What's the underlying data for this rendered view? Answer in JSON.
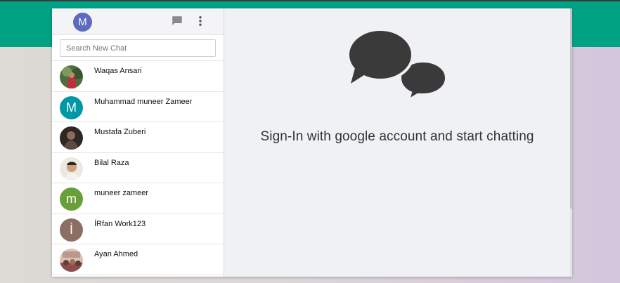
{
  "colors": {
    "top_band": "#00a284",
    "page_bg": "#d9d3da",
    "panel_bg": "#f0f1f5",
    "icon_gray": "#8a8a8a",
    "bubble_dark": "#3a3a3a"
  },
  "sidebar": {
    "me": {
      "initial": "M",
      "color": "#5c6bc0"
    },
    "header_icons": [
      "chat-bubble-icon",
      "more-vert-icon"
    ],
    "search": {
      "placeholder": "Search New Chat",
      "value": ""
    },
    "contacts": [
      {
        "name": "Waqas Ansari",
        "avatar": "photo",
        "color": "#5a7a4a"
      },
      {
        "name": "Muhammad muneer Zameer",
        "avatar": "M",
        "color": "#0097a7"
      },
      {
        "name": "Mustafa Zuberi",
        "avatar": "photo",
        "color": "#4a3b35"
      },
      {
        "name": "Bilal Raza",
        "avatar": "photo",
        "color": "#d8cfc6"
      },
      {
        "name": "muneer zameer",
        "avatar": "m",
        "color": "#689f38"
      },
      {
        "name": "İRfan Work123",
        "avatar": "İ",
        "color": "#8d6e63"
      },
      {
        "name": "Ayan Ahmed",
        "avatar": "photo",
        "color": "#9a6a5a"
      }
    ]
  },
  "main": {
    "icon": "chat-bubbles-icon",
    "tagline": "Sign-In with google account and start chatting"
  }
}
